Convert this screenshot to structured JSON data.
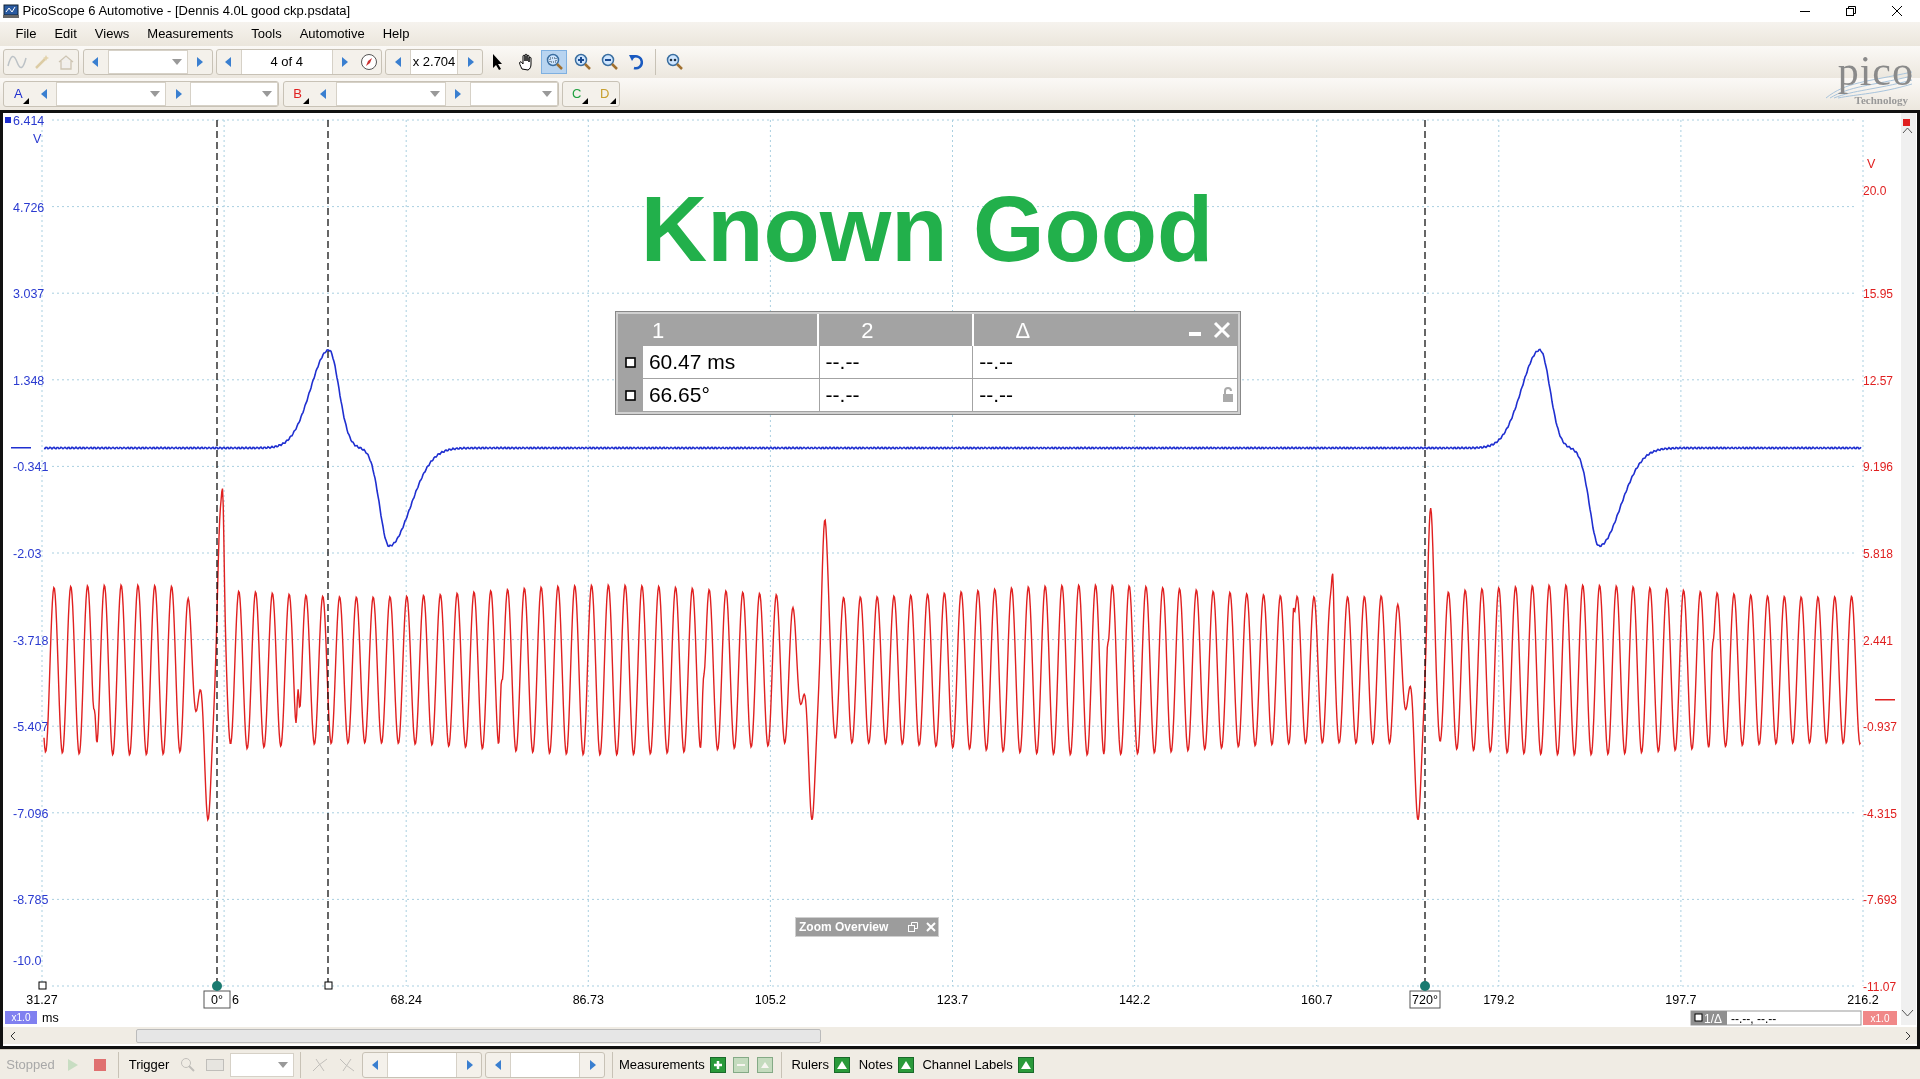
{
  "window": {
    "title": "PicoScope 6 Automotive - [Dennis 4.0L good ckp.psdata]"
  },
  "menu": [
    {
      "label": "File"
    },
    {
      "label": "Edit"
    },
    {
      "label": "Views"
    },
    {
      "label": "Measurements"
    },
    {
      "label": "Tools"
    },
    {
      "label": "Automotive"
    },
    {
      "label": "Help"
    }
  ],
  "toolbar": {
    "buffer": "4 of 4",
    "zoom": "x 2.704",
    "tools": [
      {
        "kind": "pointer",
        "selected": false
      },
      {
        "kind": "hand",
        "selected": false
      },
      {
        "kind": "zoom-region",
        "selected": true
      },
      {
        "kind": "zoom-in",
        "selected": false
      },
      {
        "kind": "zoom-out",
        "selected": false
      },
      {
        "kind": "undo-zoom",
        "selected": false
      }
    ]
  },
  "logo": {
    "name": "pico",
    "tagline": "Technology"
  },
  "channels": [
    {
      "label": "A",
      "color": "#1f2fd0"
    },
    {
      "label": "B",
      "color": "#e02020"
    },
    {
      "label": "C",
      "color": "#20a040"
    },
    {
      "label": "D",
      "color": "#c8a030"
    }
  ],
  "scope": {
    "note": "Known Good",
    "left_axis": {
      "unit": "V",
      "scale": "x1.0",
      "ticks": [
        "6.414",
        "4.726",
        "3.037",
        "1.348",
        "-0.341",
        "-2.03",
        "-3.718",
        "-5.407",
        "-7.096",
        "-8.785",
        "-10.0"
      ]
    },
    "right_axis": {
      "unit": "V",
      "scale": "x1.0",
      "ticks": [
        "20.0",
        "15.95",
        "12.57",
        "9.196",
        "5.818",
        "2.441",
        "-0.937",
        "-4.315",
        "-7.693",
        "-11.07"
      ]
    },
    "x_axis": {
      "unit": "ms",
      "ticks": [
        "31.27",
        "6",
        "68.24",
        "86.73",
        "105.2",
        "123.7",
        "142.2",
        "160.7",
        "179.2",
        "197.7",
        "216.2"
      ]
    },
    "rulers": [
      "0°",
      "720°"
    ],
    "measurement_table": {
      "columns": [
        "1",
        "2",
        "Δ"
      ],
      "rows": [
        {
          "checked": false,
          "cells": [
            "60.47 ms",
            "--.--",
            "--.--"
          ]
        },
        {
          "checked": false,
          "cells": [
            "66.65°",
            "--.--",
            "--.--"
          ]
        }
      ]
    },
    "zoom_overview": "Zoom Overview",
    "ruler_readout": {
      "label": "1/Δ",
      "value": "--.--, --.--"
    }
  },
  "status_bar": {
    "run_state": "Stopped",
    "trigger": "Trigger",
    "measurements": "Measurements",
    "toggles": [
      "Rulers",
      "Notes",
      "Channel Labels"
    ]
  }
}
